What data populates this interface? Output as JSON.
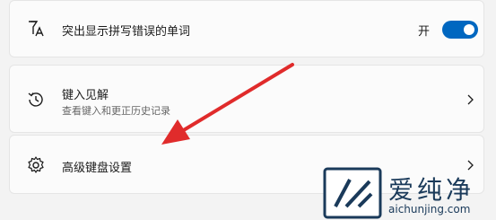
{
  "settings": {
    "spell": {
      "title": "突出显示拼写错误的单词",
      "toggle_label": "开",
      "toggle_on": true,
      "icon": "spell-check-icon"
    },
    "insights": {
      "title": "键入见解",
      "subtitle": "查看键入和更正历史记录",
      "icon": "history-icon"
    },
    "advanced": {
      "title": "高级键盘设置",
      "icon": "gear-icon"
    }
  },
  "watermark": {
    "text": "爱纯净",
    "url": "aichunjing.com"
  },
  "colors": {
    "accent": "#0067c0",
    "arrow": "#e02b2b",
    "watermark": "#1a3a5a"
  }
}
